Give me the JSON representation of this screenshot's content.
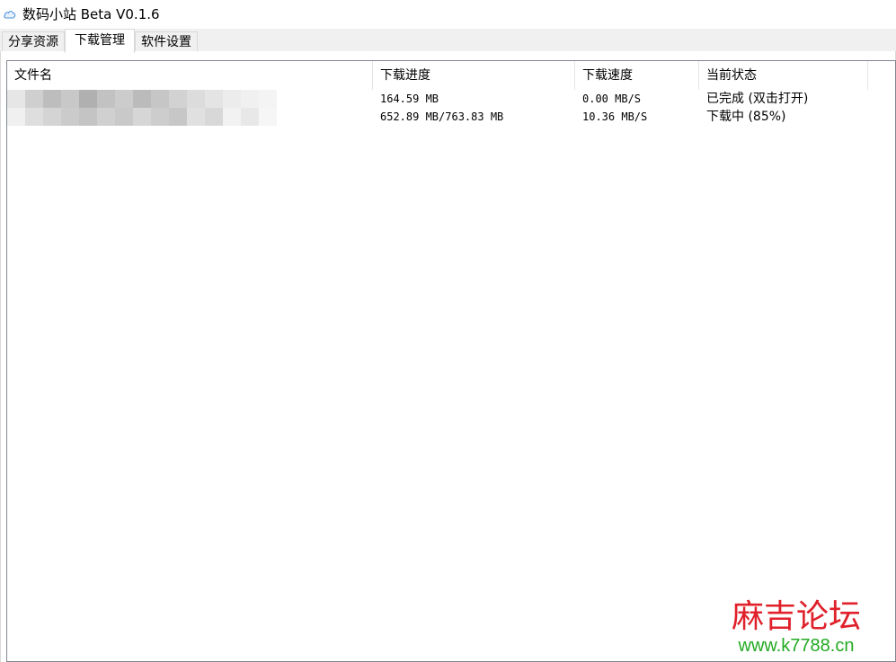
{
  "window": {
    "title": "数码小站 Beta V0.1.6",
    "icon": "cloud-icon"
  },
  "tabs": [
    {
      "label": "分享资源",
      "active": false
    },
    {
      "label": "下载管理",
      "active": true
    },
    {
      "label": "软件设置",
      "active": false
    }
  ],
  "table": {
    "columns": [
      "文件名",
      "下载进度",
      "下载速度",
      "当前状态"
    ],
    "rows": [
      {
        "name": "",
        "progress": "164.59 MB",
        "speed": "0.00 MB/S",
        "status": "已完成 (双击打开)"
      },
      {
        "name": "",
        "progress": "652.89 MB/763.83 MB",
        "speed": "10.36 MB/S",
        "status": "下载中 (85%)"
      }
    ]
  },
  "watermark": {
    "title": "麻吉论坛",
    "url": "www.k7788.cn"
  },
  "colors": {
    "watermark_title": "#e0202a",
    "watermark_url": "#22aa22",
    "tab_bg": "#f0f0f0",
    "border": "#828790"
  }
}
